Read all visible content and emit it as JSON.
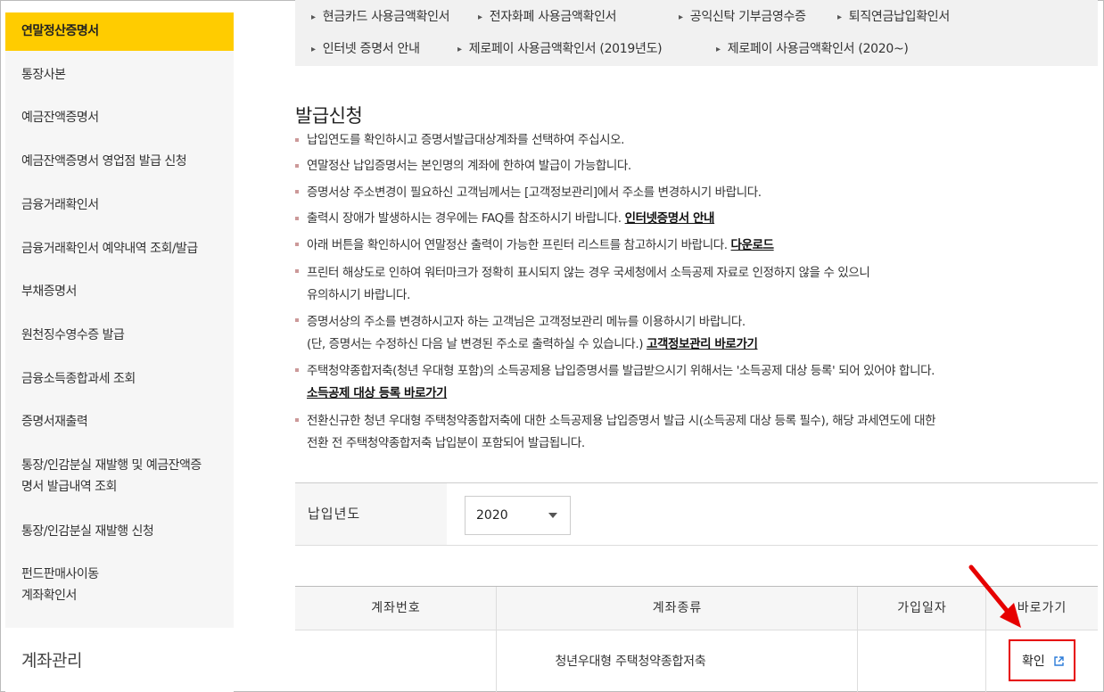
{
  "sidebar": {
    "items": [
      {
        "label": "연말정산증명서",
        "active": true
      },
      {
        "label": "통장사본"
      },
      {
        "label": "예금잔액증명서"
      },
      {
        "label": "예금잔액증명서 영업점 발급 신청"
      },
      {
        "label": "금융거래확인서"
      },
      {
        "label": "금융거래확인서 예약내역 조회/발급"
      },
      {
        "label": "부채증명서"
      },
      {
        "label": "원천징수영수증 발급"
      },
      {
        "label": "금융소득종합과세 조회"
      },
      {
        "label": "증명서재출력"
      },
      {
        "label_line1": "통장/인감분실 재발행 및 예금잔액증",
        "label_line2": "명서 발급내역 조회"
      },
      {
        "label": "통장/인감분실 재발행 신청"
      },
      {
        "label_line1": "펀드판매사이동",
        "label_line2": "계좌확인서"
      }
    ],
    "section": "계좌관리"
  },
  "links": [
    "현금카드 사용금액확인서",
    "전자화폐 사용금액확인서",
    "공익신탁 기부금영수증",
    "퇴직연금납입확인서",
    "인터넷 증명서 안내",
    "제로페이 사용금액확인서 (2019년도)",
    "제로페이 사용금액확인서 (2020~)"
  ],
  "heading": "발급신청",
  "notes": {
    "n1": "납입연도를 확인하시고 증명서발급대상계좌를 선택하여 주십시오.",
    "n2": "연말정산 납입증명서는 본인명의 계좌에 한하여 발급이 가능합니다.",
    "n3": "증명서상 주소변경이 필요하신 고객님께서는 [고객정보관리]에서 주소를 변경하시기 바랍니다.",
    "n4": "출력시 장애가 발생하시는 경우에는 FAQ를 참조하시기 바랍니다.",
    "n4_link": "인터넷증명서 안내",
    "n5": "아래 버튼을 확인하시어 연말정산 출력이 가능한 프린터 리스트를 참고하시기 바랍니다.",
    "n5_link": "다운로드",
    "n6_line1": "프린터 해상도로 인하여 워터마크가 정확히 표시되지 않는 경우 국세청에서 소득공제 자료로 인정하지 않을 수 있으니",
    "n6_line2": "유의하시기 바랍니다.",
    "n7_line1": "증명서상의 주소를 변경하시고자 하는 고객님은 고객정보관리 메뉴를 이용하시기 바랍니다.",
    "n7_line2": "(단, 증명서는 수정하신 다음 날 변경된 주소로 출력하실 수 있습니다.)",
    "n7_link": "고객정보관리 바로가기",
    "n8_line1": "주택청약종합저축(청년 우대형 포함)의 소득공제용 납입증명서를 발급받으시기 위해서는 '소득공제 대상 등록' 되어 있어야 합니다.",
    "n8_link": "소득공제 대상 등록 바로가기",
    "n9_line1": "전환신규한 청년 우대형 주택청약종합저축에 대한 소득공제용 납입증명서 발급 시(소득공제 대상 등록 필수), 해당 과세연도에 대한",
    "n9_line2": "전환 전 주택청약종합저축 납입분이 포함되어 발급됩니다."
  },
  "year": {
    "label": "납입년도",
    "selected": "2020"
  },
  "table": {
    "headers": [
      "계좌번호",
      "계좌종류",
      "가입일자",
      "바로가기"
    ],
    "rows": [
      {
        "account_no": "",
        "account_type": "청년우대형 주택청약종합저축",
        "join_date": "",
        "action": "확인"
      }
    ]
  },
  "colors": {
    "active": "#ffcc00",
    "highlight": "#e60000"
  }
}
